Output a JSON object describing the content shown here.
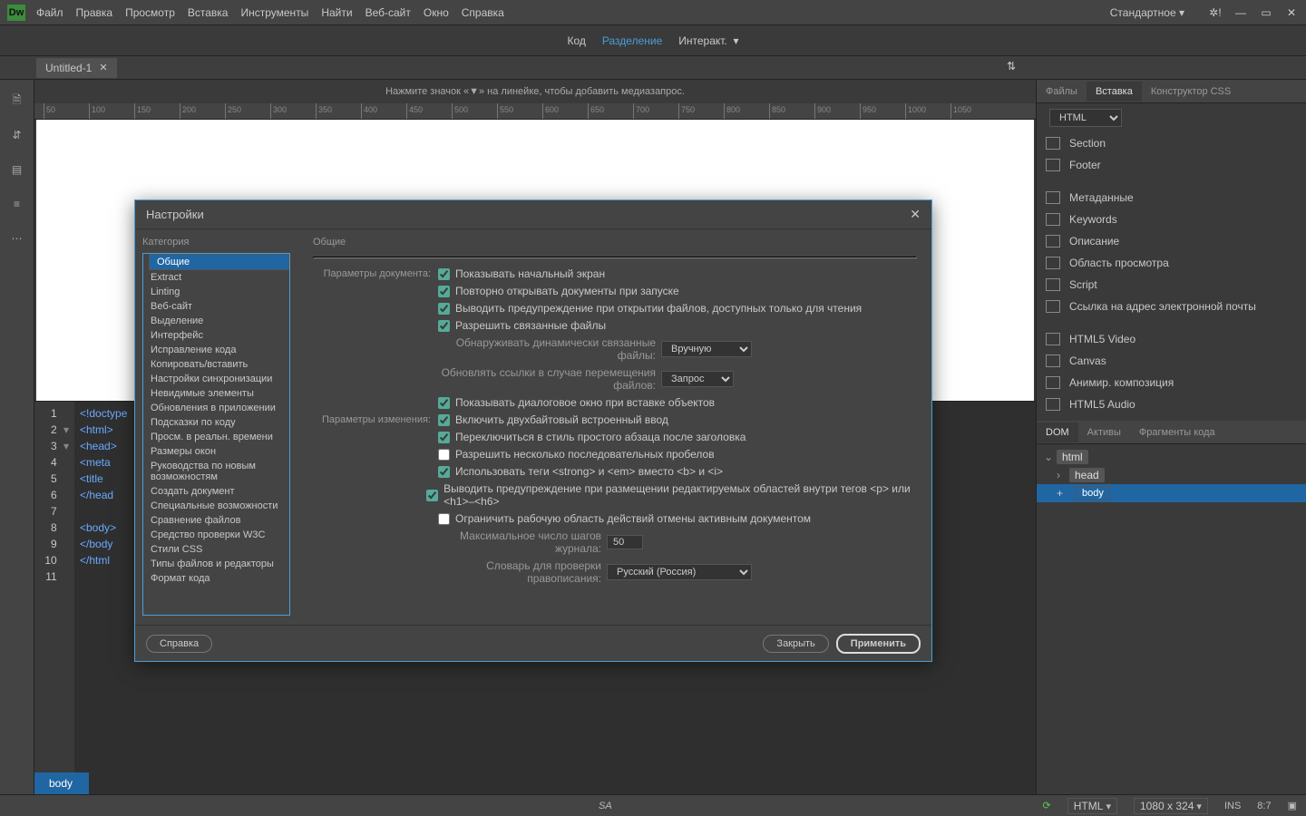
{
  "menubar": {
    "items": [
      "Файл",
      "Правка",
      "Просмотр",
      "Вставка",
      "Инструменты",
      "Найти",
      "Веб-сайт",
      "Окно",
      "Справка"
    ],
    "workspace": "Стандартное"
  },
  "toolbar": {
    "code": "Код",
    "split": "Разделение",
    "live": "Интеракт."
  },
  "doc_tab": "Untitled-1",
  "hint": "Нажмите значок «▼» на линейке, чтобы добавить медиазапрос.",
  "ruler_ticks": [
    "50",
    "100",
    "150",
    "200",
    "250",
    "300",
    "350",
    "400",
    "450",
    "500",
    "550",
    "600",
    "650",
    "700",
    "750",
    "800",
    "850",
    "900",
    "950",
    "1000",
    "1050"
  ],
  "code_lines": [
    {
      "n": 1,
      "fold": "",
      "html": "<span class='tok-doctype'>&lt;!doctype</span>"
    },
    {
      "n": 2,
      "fold": "▾",
      "html": "<span class='tok-tag'>&lt;html&gt;</span>"
    },
    {
      "n": 3,
      "fold": "▾",
      "html": "<span class='tok-tag'>&lt;head&gt;</span>"
    },
    {
      "n": 4,
      "fold": "",
      "html": "<span class='tok-tag'>&lt;meta</span>"
    },
    {
      "n": 5,
      "fold": "",
      "html": "<span class='tok-tag'>&lt;title</span>"
    },
    {
      "n": 6,
      "fold": "",
      "html": "<span class='tok-tag'>&lt;/head</span>"
    },
    {
      "n": 7,
      "fold": "",
      "html": ""
    },
    {
      "n": 8,
      "fold": "",
      "html": "<span class='tok-tag'>&lt;body&gt;</span>"
    },
    {
      "n": 9,
      "fold": "",
      "html": "<span class='tok-tag'>&lt;/body</span>"
    },
    {
      "n": 10,
      "fold": "",
      "html": "<span class='tok-tag'>&lt;/html</span>"
    },
    {
      "n": 11,
      "fold": "",
      "html": ""
    }
  ],
  "breadcrumb": "body",
  "right": {
    "tabs": [
      "Файлы",
      "Вставка",
      "Конструктор CSS"
    ],
    "active_tab": 1,
    "selector": "HTML",
    "insert_groups": [
      [
        "Section",
        "Footer"
      ],
      [
        "Метаданные",
        "Keywords",
        "Описание",
        "Область просмотра",
        "Script",
        "Ссылка на адрес электронной почты"
      ],
      [
        "HTML5 Video",
        "Canvas",
        "Аними­р. композиция",
        "HTML5 Audio"
      ]
    ],
    "dom_tabs": [
      "DOM",
      "Активы",
      "Фрагменты кода"
    ],
    "dom_tree": [
      "html",
      "head",
      "body"
    ]
  },
  "prefs": {
    "title": "Настройки",
    "cat_header": "Категория",
    "section_header": "Общие",
    "categories": [
      "Общие",
      "Extract",
      "Linting",
      "Веб-сайт",
      "Выделение",
      "Интерфейс",
      "Исправление кода",
      "Копировать/вставить",
      "Настройки синхронизации",
      "Невидимые элементы",
      "Обновления в приложении",
      "Подсказки по коду",
      "Просм. в реальн. времени",
      "Размеры окон",
      "Руководства по новым возможностям",
      "Создать документ",
      "Специальные возможности",
      "Сравнение файлов",
      "Средство проверки W3C",
      "Стили CSS",
      "Типы файлов и редакторы",
      "Формат кода"
    ],
    "selected_category": 0,
    "doc_params_label": "Параметры документа:",
    "edit_params_label": "Параметры изменения:",
    "checks": {
      "show_start": "Показывать начальный экран",
      "reopen": "Повторно открывать документы при запуске",
      "warn_readonly": "Выводить предупреждение при открытии файлов, доступных только для чтения",
      "allow_related": "Разрешить связанные файлы",
      "dyn_label": "Обнаруживать динамически связанные файлы:",
      "dyn_value": "Вручную",
      "upd_links_label": "Обновлять ссылки в случае перемещения файлов:",
      "upd_links_value": "Запрос",
      "show_dlg_insert": "Показывать диалоговое окно при вставке объектов",
      "dbcs": "Включить двухбайтовый встроенный ввод",
      "switch_para": "Переключиться в стиль простого абзаца после заголовка",
      "multi_spaces": "Разрешить несколько последовательных пробелов",
      "strong_em": "Использовать теги <strong> и <em> вместо <b> и <i>",
      "warn_edit_region": "Выводить предупреждение при размещении редактируемых областей внутри тегов <p> или <h1>–<h6>",
      "limit_undo": "Ограничить рабочую область действий отмены активным документом",
      "max_undo_label": "Максимальное число шагов журнала:",
      "max_undo_value": "50",
      "dict_label": "Словарь для проверки правописания:",
      "dict_value": "Русский (Россия)"
    },
    "buttons": {
      "help": "Справка",
      "close": "Закрыть",
      "apply": "Применить"
    }
  },
  "status": {
    "lang": "HTML",
    "dims": "1080 x 324",
    "ins": "INS",
    "pos": "8:7",
    "sa": "SA"
  }
}
